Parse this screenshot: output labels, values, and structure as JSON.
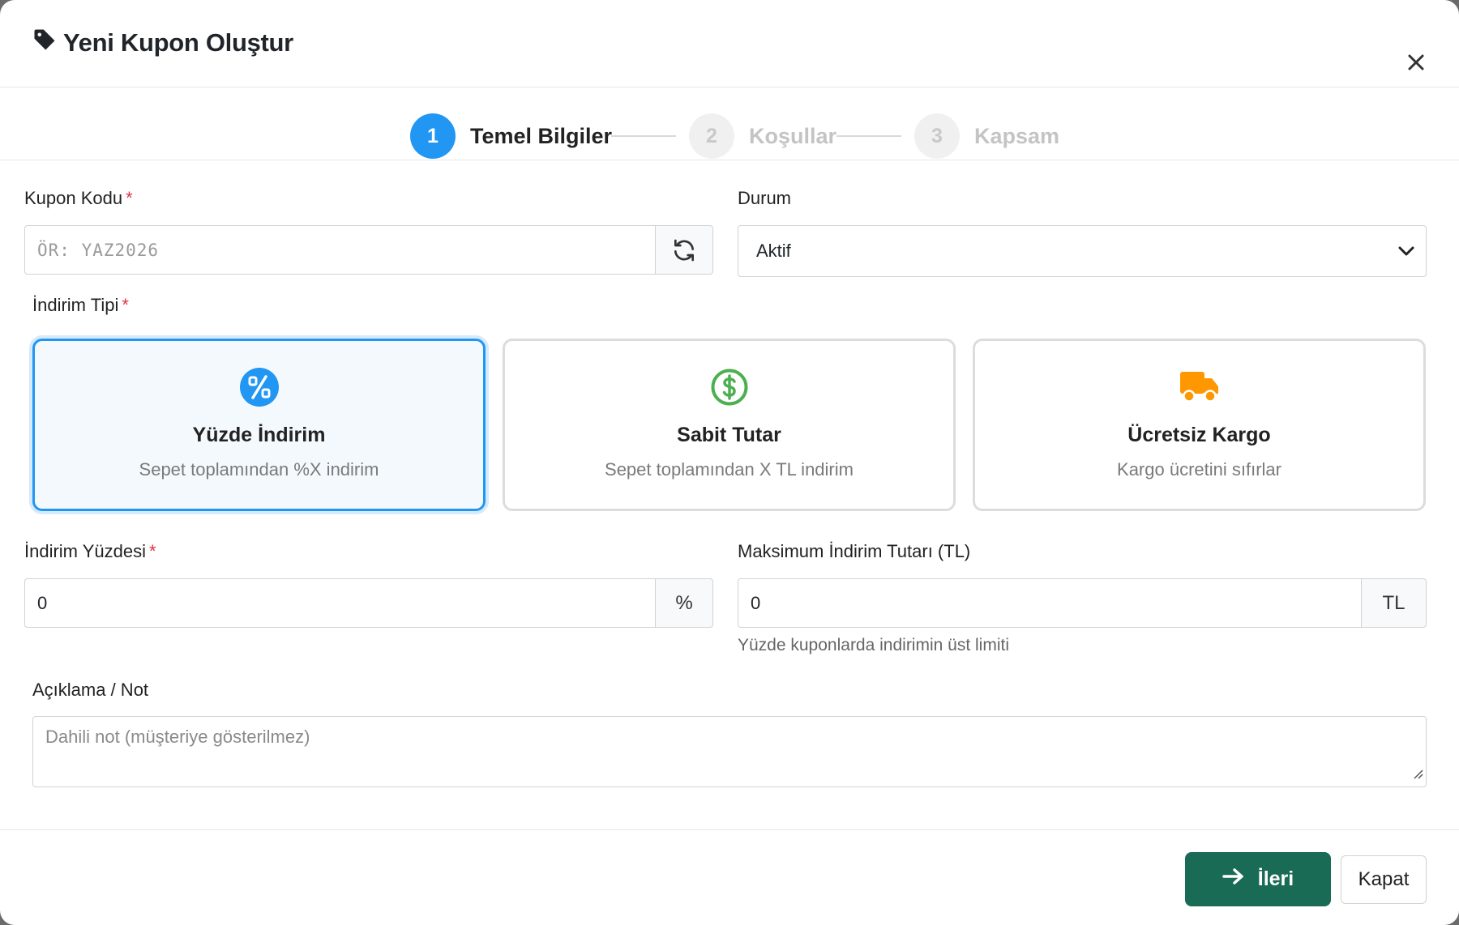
{
  "modal": {
    "title": "Yeni Kupon Oluştur",
    "title_icon": "tag-icon",
    "close_icon": "close-icon"
  },
  "stepper": {
    "steps": [
      {
        "number": "1",
        "label": "Temel Bilgiler",
        "state": "active"
      },
      {
        "number": "2",
        "label": "Koşullar",
        "state": "inactive"
      },
      {
        "number": "3",
        "label": "Kapsam",
        "state": "inactive"
      }
    ]
  },
  "form": {
    "coupon_code": {
      "label": "Kupon Kodu",
      "required_mark": "*",
      "placeholder": "ÖR: YAZ2026",
      "value": "",
      "refresh_icon": "refresh-icon"
    },
    "status": {
      "label": "Durum",
      "selected": "Aktif"
    },
    "discount_type": {
      "label": "İndirim Tipi",
      "required_mark": "*",
      "options": [
        {
          "title": "Yüzde İndirim",
          "description": "Sepet toplamından %X indirim",
          "icon": "percent-icon",
          "color": "#2196f3",
          "selected": true
        },
        {
          "title": "Sabit Tutar",
          "description": "Sepet toplamından X TL indirim",
          "icon": "dollar-icon",
          "color": "#4caf50",
          "selected": false
        },
        {
          "title": "Ücretsiz Kargo",
          "description": "Kargo ücretini sıfırlar",
          "icon": "truck-icon",
          "color": "#ff9800",
          "selected": false
        }
      ]
    },
    "discount_percent": {
      "label": "İndirim Yüzdesi",
      "required_mark": "*",
      "value": "0",
      "addon": "%"
    },
    "max_discount": {
      "label": "Maksimum İndirim Tutarı (TL)",
      "value": "0",
      "addon": "TL",
      "help": "Yüzde kuponlarda indirimin üst limiti"
    },
    "note": {
      "label": "Açıklama / Not",
      "placeholder": "Dahili not (müşteriye gösterilmez)"
    }
  },
  "footer": {
    "next_label": "İleri",
    "next_icon": "arrow-right-icon",
    "close_label": "Kapat"
  },
  "colors": {
    "primary": "#2196f3",
    "next_button": "#1a6b55",
    "required": "#dc3545"
  }
}
